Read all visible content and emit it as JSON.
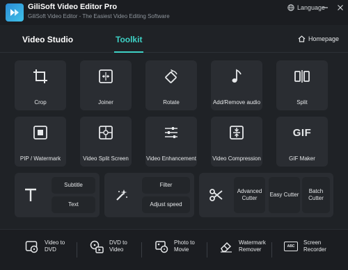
{
  "app": {
    "title": "GiliSoft Video Editor Pro",
    "subtitle": "GiliSoft Video Editor - The Easiest Video Editing Software",
    "language_label": "Language"
  },
  "tabs": [
    {
      "label": "Video Studio",
      "active": false
    },
    {
      "label": "Toolkit",
      "active": true
    }
  ],
  "homepage_label": "Homepage",
  "tools_row1": [
    {
      "label": "Crop",
      "icon": "crop-icon"
    },
    {
      "label": "Joiner",
      "icon": "joiner-icon"
    },
    {
      "label": "Rotate",
      "icon": "rotate-icon"
    },
    {
      "label": "Add/Remove audio",
      "icon": "music-note-icon"
    },
    {
      "label": "Split",
      "icon": "split-icon"
    }
  ],
  "tools_row2": [
    {
      "label": "PIP / Watermark",
      "icon": "pip-icon"
    },
    {
      "label": "Video Split Screen",
      "icon": "split-screen-icon"
    },
    {
      "label": "Video Enhancement",
      "icon": "sliders-icon"
    },
    {
      "label": "Video Compression",
      "icon": "compression-icon"
    },
    {
      "label": "GIF Maker",
      "icon": "gif-icon",
      "glyph": "GIF"
    }
  ],
  "group_text": {
    "subtitle": "Subtitle",
    "text": "Text"
  },
  "group_effects": {
    "filter": "Filter",
    "adjust_speed": "Adjust speed"
  },
  "group_cutter": {
    "advanced": "Advanced Cutter",
    "easy": "Easy Cutter",
    "batch": "Batch Cutter"
  },
  "bottom_tools": [
    {
      "label": "Video to DVD",
      "icon": "disc-icon"
    },
    {
      "label": "DVD to Video",
      "icon": "dvd-to-video-icon"
    },
    {
      "label": "Photo to Movie",
      "icon": "photo-movie-icon"
    },
    {
      "label": "Watermark Remover",
      "icon": "eraser-icon"
    },
    {
      "label": "Screen Recorder",
      "icon": "screen-recorder-icon",
      "glyph": "ABC"
    }
  ],
  "colors": {
    "accent": "#3ed2c6",
    "background": "#1f2226",
    "card": "#2a2d32"
  }
}
